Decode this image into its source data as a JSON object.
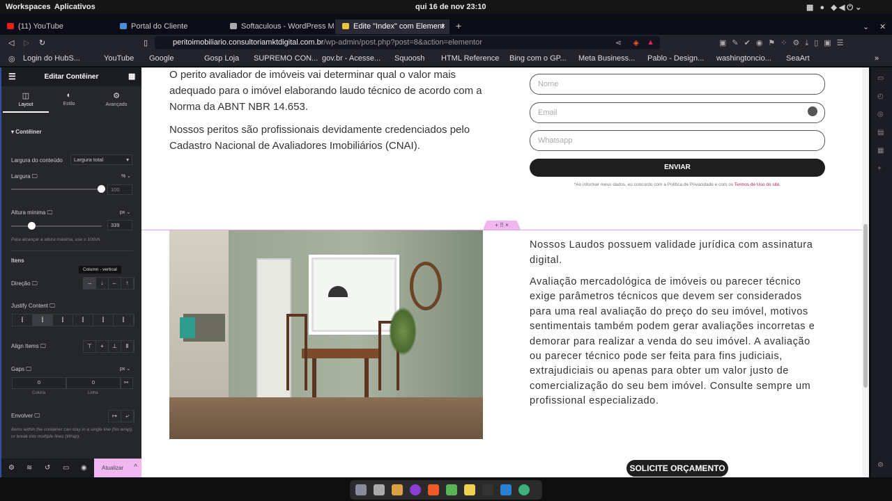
{
  "os": {
    "workspaces": "Workspaces",
    "apps": "Aplicativos",
    "clock": "qui 16 de nov  23:10"
  },
  "browser": {
    "tabs": [
      {
        "label": "(11) YouTube",
        "color": "#e62117"
      },
      {
        "label": "Portal do Cliente",
        "color": "#4a8fd8"
      },
      {
        "label": "Softaculous - WordPress Man",
        "color": "#aaaaaa"
      },
      {
        "label": "Edite \"Index\" com Element",
        "color": "#e8c440"
      }
    ],
    "new_tab": "+",
    "url_host": "peritoimobiliario.consultoriamktdigital.com.br",
    "url_path": "/wp-admin/post.php?post=8&action=elementor",
    "bookmarks": [
      "Login do HubS...",
      "YouTube",
      "Google",
      "Gosp Loja",
      "SUPREMO CON...",
      "gov.br - Acesse...",
      "Squoosh",
      "HTML Reference",
      "Bing com o GP...",
      "Meta Business...",
      "Pablo - Design...",
      "washingtoncio...",
      "SeaArt"
    ],
    "more": "»"
  },
  "panel": {
    "title": "Editar Contêiner",
    "tabs": [
      "Layout",
      "Estilo",
      "Avançado"
    ],
    "section": "Contêiner",
    "content_width_label": "Largura do conteúdo",
    "content_width_value": "Largura total",
    "width_label": "Largura",
    "width_unit": "% ⌄",
    "width_value": "100",
    "width_fill": 1.0,
    "min_height_label": "Altura mínima",
    "min_height_unit": "px ⌄",
    "min_height_value": "339",
    "min_height_fill": 0.23,
    "min_height_note": "Para alcançar a altura máxima, use o 100vh.",
    "items_heading": "Itens",
    "tooltip": "Column - vertical",
    "direction_label": "Direção",
    "justify_label": "Justify Content",
    "align_label": "Align Items",
    "gaps_label": "Gaps",
    "gaps_unit": "px ⌄",
    "gap_column": "0",
    "gap_row": "0",
    "gap_column_label": "Coluna",
    "gap_row_label": "Linha",
    "wrap_label": "Envolver",
    "wrap_note": "Items within the container can stay in a single line (No wrap), or break into multiple lines (Wrap).",
    "update": "Atualizar"
  },
  "page": {
    "para1": "O perito avaliador de imóveis vai determinar qual o valor mais adequado para o imóvel elaborando laudo técnico de acordo com a Norma da ABNT NBR 14.653.",
    "para2": "Nossos peritos são profissionais devidamente credenciados pelo Cadastro Nacional de Avaliadores Imobiliários (CNAI).",
    "form": {
      "name": "Nome",
      "email": "Email",
      "whatsapp": "Whatsapp",
      "submit": "ENVIAR",
      "disclaimer": "*Ao informar meus dados, eu concordo com a Política de Privacidade e com os ",
      "terms": "Termos de Uso do site."
    },
    "section_controls": "+  ⠿  ×",
    "para3": "Nossos Laudos possuem validade jurídica com assinatura digital.",
    "para4": "Avaliação mercadológica de imóveis ou parecer técnico exige parâmetros técnicos que devem ser considerados para uma real avaliação do preço do seu imóvel, motivos sentimentais também podem gerar avaliações incorretas e demorar para realizar a venda do seu imóvel. A avaliação ou parecer técnico pode ser feita para fins judiciais, extrajudiciais ou apenas para obter um valor justo de comercialização do seu bem imóvel. Consulte sempre um profissional especializado.",
    "cta": "SOLICITE ORÇAMENTO"
  }
}
